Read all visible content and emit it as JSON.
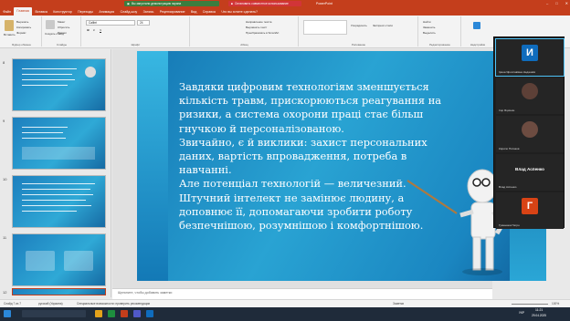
{
  "titlebar": {
    "banner_green": "Вы запустили демонстрацию экрана",
    "banner_red": "Остановить совместное использование",
    "title": "PowerPoint",
    "window_controls": [
      "–",
      "□",
      "✕"
    ]
  },
  "ribbon_tabs": [
    "Файл",
    "Главная",
    "Вставка",
    "Конструктор",
    "Переходы",
    "Анимация",
    "Слайд-шоу",
    "Запись",
    "Рецензирование",
    "Вид",
    "Справка",
    "Что вы хотите сделать?"
  ],
  "ribbon_groups": [
    {
      "label": "Буфер обмена",
      "items": [
        "Вставить",
        "Вырезать",
        "Копировать",
        "Формат"
      ]
    },
    {
      "label": "Слайды",
      "items": [
        "Создать слайд",
        "Макет",
        "Сбросить",
        "Раздел"
      ]
    },
    {
      "label": "Шрифт",
      "items": [
        "Calibri",
        "24",
        "Ж",
        "К",
        "Ч"
      ]
    },
    {
      "label": "Абзац",
      "items": [
        "Направление текста",
        "Выровнять текст",
        "Преобразовать в SmartArt"
      ]
    },
    {
      "label": "Рисование",
      "items": [
        "Фигуры",
        "Упорядочить",
        "Экспресс-стили"
      ]
    },
    {
      "label": "Редактирование",
      "items": [
        "Найти",
        "Заменить",
        "Выделить"
      ]
    },
    {
      "label": "Надстройки",
      "items": [
        "Надстройки"
      ]
    }
  ],
  "thumbnails": [
    {
      "num": "8"
    },
    {
      "num": "9"
    },
    {
      "num": "10"
    },
    {
      "num": "11"
    },
    {
      "num": "12"
    }
  ],
  "slide": {
    "lines": [
      "Завдяки цифровим технологіям зменшується",
      "кількість травм, прискорюються реагування на",
      "ризики, а система охорони праці стає більш",
      "гнучкою й персоналізованою.",
      "Звичайно, є й виклики: захист персональних",
      "даних, вартість впровадження, потреба в",
      "навчанні.",
      "Але потенціал технологій — величезний.",
      "Штучний інтелект не замінює людину, а",
      "доповнює її, допомагаючи зробити роботу",
      "безпечнішою, розумнішою і комфортнішою."
    ]
  },
  "notes": "Щелкните, чтобы добавить заметки",
  "status": {
    "slide_counter": "Слайд 7 из 7",
    "language": "русский (Украина)",
    "accessibility": "Специальные возможности: проверить рекомендации",
    "notes_btn": "Заметки",
    "zoom": "100%"
  },
  "video": {
    "participants": [
      {
        "initial": "И",
        "name": "Ірина Ярославівна Недашків",
        "color": "#0f6cbd"
      },
      {
        "initial": "",
        "name": "Ігор Яцишин",
        "color": "#5d4037"
      },
      {
        "initial": "",
        "name": "Кирило Пятаков",
        "color": "#6d4c41"
      },
      {
        "initial": "",
        "name": "Влад Аспенко",
        "big": "Влад Аспенко",
        "color": "#252525"
      },
      {
        "initial": "Г",
        "name": "Гуменюка Петро",
        "color": "#d84315"
      }
    ]
  },
  "taskbar": {
    "time": "11:21",
    "date": "29.04.2025",
    "lang": "УКР"
  }
}
